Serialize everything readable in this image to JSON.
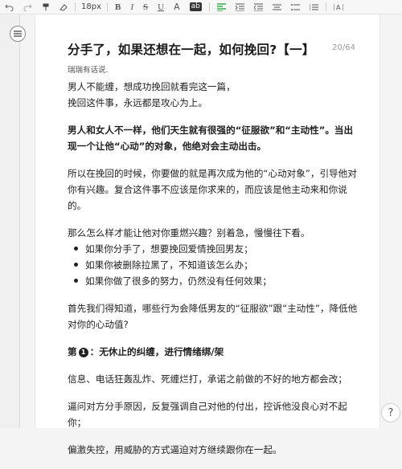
{
  "toolbar": {
    "font_size": "18px",
    "bold": "B",
    "italic": "I",
    "strike": "S",
    "underline": "U",
    "font_color": "A",
    "highlight": "ab",
    "icons": [
      "undo-icon",
      "redo-icon",
      "format-brush-icon",
      "clear-format-icon",
      "align-icon",
      "indent-icon",
      "outdent-icon",
      "list-icon",
      "ordered-list-icon",
      "more-icon"
    ]
  },
  "document": {
    "title": "分手了，如果还想在一起，如何挽回?【一】",
    "counter": "20/64",
    "author": "瑞瑞有话说.",
    "paragraphs": {
      "p1_l1": "男人不能缠，想成功挽回就看完这一篇，",
      "p1_l2": "挽回这件事，永远都是攻心为上。",
      "p2": "男人和女人不一样，他们天生就有很强的“征服欲”和“主动性”。当出现一个让他“心动”的对象，他绝对会主动出击。",
      "p3": "所以在挽回的时候，你要做的就是再次成为他的“心动对象”，引导他对你有兴趣。复合这件事不应该是你求来的，而应该是他主动来和你说的。",
      "p4": "那么怎么样才能让他对你重燃兴趣？别着急，慢慢往下看。",
      "p5": "首先我们得知道，哪些行为会降低男友的“征服欲”跟“主动性”，降低他对你的心动值?"
    },
    "bullets": [
      "如果你分手了，想要挽回爱情挽回男友；",
      "如果你被删除拉黑了，不知道该怎么办；",
      "如果你做了很多的努力，仍然没有任何效果；"
    ],
    "section1": {
      "prefix": "第",
      "number": "1",
      "title": "：无休止的纠缠，进行情绪绑/架"
    },
    "section1_lines": [
      "信息、电话狂轰乱炸、死缠烂打，承诺之前做的不好的地方都会改；",
      "逼问对方分手原因，反复强调自己对他的付出，控诉他没良心对不起你；",
      "偏激失控，用威胁的方式逼迫对方继续跟你在一起。"
    ]
  },
  "help_label": "?",
  "colors": {
    "accent_green": "#2fae4c",
    "page_bg": "#ffffff",
    "canvas_bg": "#f4f4f4"
  }
}
